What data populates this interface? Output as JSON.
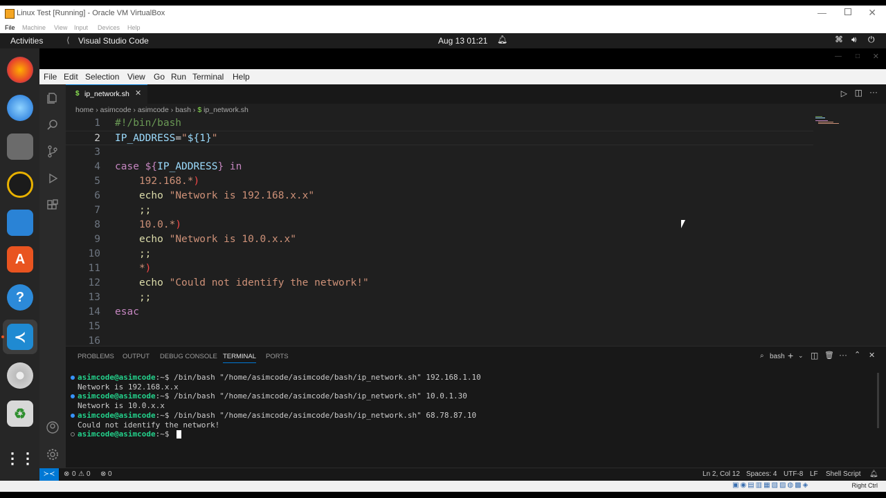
{
  "host": {
    "title": "Linux Test [Running] - Oracle VM VirtualBox",
    "menu": [
      "File",
      "Machine",
      "View",
      "Input",
      "Devices",
      "Help"
    ],
    "right_ctrl": "Right Ctrl"
  },
  "topbar": {
    "activities": "Activities",
    "app": "Visual Studio Code",
    "clock": "Aug 13  01:21"
  },
  "vscode": {
    "menu": [
      "File",
      "Edit",
      "Selection",
      "View",
      "Go",
      "Run",
      "Terminal",
      "Help"
    ],
    "tab_label": "ip_network.sh",
    "tab_icon": "$",
    "breadcrumb": [
      "home",
      "asimcode",
      "asimcode",
      "bash",
      "ip_network.sh"
    ],
    "code_lines": [
      {
        "n": "1",
        "text": "#!/bin/bash"
      },
      {
        "n": "2",
        "text": "IP_ADDRESS=\"${1}\""
      },
      {
        "n": "3",
        "text": ""
      },
      {
        "n": "4",
        "text": "case ${IP_ADDRESS} in"
      },
      {
        "n": "5",
        "text": "    192.168.*)"
      },
      {
        "n": "6",
        "text": "    echo \"Network is 192.168.x.x\""
      },
      {
        "n": "7",
        "text": "    ;;"
      },
      {
        "n": "8",
        "text": "    10.0.*)"
      },
      {
        "n": "9",
        "text": "    echo \"Network is 10.0.x.x\""
      },
      {
        "n": "10",
        "text": "    ;;"
      },
      {
        "n": "11",
        "text": "    *)"
      },
      {
        "n": "12",
        "text": "    echo \"Could not identify the network!\""
      },
      {
        "n": "13",
        "text": "    ;;"
      },
      {
        "n": "14",
        "text": "esac"
      },
      {
        "n": "15",
        "text": ""
      },
      {
        "n": "16",
        "text": ""
      }
    ],
    "panel_tabs": [
      "PROBLEMS",
      "OUTPUT",
      "DEBUG CONSOLE",
      "TERMINAL",
      "PORTS"
    ],
    "active_panel_tab": "TERMINAL",
    "terminal_name": "bash",
    "terminal": {
      "prompt": "asimcode@asimcode",
      "lines": [
        {
          "cmd": ":~$ /bin/bash \"/home/asimcode/asimcode/bash/ip_network.sh\" 192.168.1.10",
          "out": "Network is 192.168.x.x"
        },
        {
          "cmd": ":~$ /bin/bash \"/home/asimcode/asimcode/bash/ip_network.sh\" 10.0.1.30",
          "out": "Network is 10.0.x.x"
        },
        {
          "cmd": ":~$ /bin/bash \"/home/asimcode/asimcode/bash/ip_network.sh\" 68.78.87.10",
          "out": "Could not identify the network!"
        }
      ],
      "last_prompt_suffix": ":~$ "
    },
    "status": {
      "errors": "0",
      "warnings": "0",
      "ports": "0",
      "position": "Ln 2, Col 12",
      "spaces": "Spaces: 4",
      "encoding": "UTF-8",
      "eol": "LF",
      "language": "Shell Script"
    }
  },
  "colors": {
    "comment": "#6a9955",
    "variable": "#9cdcfe",
    "string": "#ce9178",
    "keyword": "#c586c0",
    "builtin": "#dcdcaa",
    "prompt": "#23d18b"
  }
}
